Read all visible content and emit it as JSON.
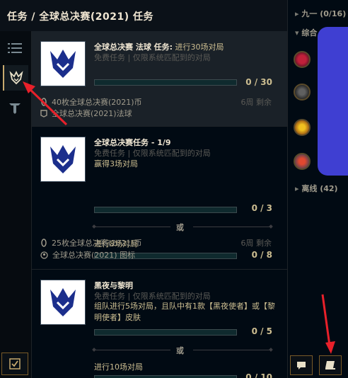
{
  "header": {
    "title": "任务 / 全球总决赛(2021) 任务"
  },
  "nav": {
    "items": [
      {
        "name": "nav-list"
      },
      {
        "name": "nav-worlds"
      },
      {
        "name": "nav-tft"
      }
    ]
  },
  "missions": [
    {
      "title": "全球总决赛 法球 任务:",
      "title_rest": " 进行30场对局",
      "subtitle": "免费任务 | 仅限系统匹配到的对局",
      "progress": "0 / 30",
      "progress_value": 0,
      "time_left": "6周 剩余",
      "rewards": [
        "40枚全球总决赛(2021)币",
        "全球总决赛(2021)法球"
      ]
    },
    {
      "title": "全球总决赛任务 - 1/9",
      "subtitle": "免费任务 | 仅限系统匹配到的对局",
      "objectives": [
        {
          "text": "赢得3场对局",
          "progress": "0 / 3"
        },
        {
          "text": "进行8场对局",
          "progress": "0 / 8"
        }
      ],
      "or_label": "或",
      "time_left": "6周 剩余",
      "rewards": [
        "25枚全球总决赛(2021)币",
        "全球总决赛(2021) 图标"
      ]
    },
    {
      "title": "黑夜与黎明",
      "subtitle": "免费任务 | 仅限系统匹配到的对局",
      "objectives": [
        {
          "text": "组队进行5场对局，且队中有1款【黑夜使者】或【黎明使者】皮肤",
          "progress": "0 / 5"
        },
        {
          "text": "进行10场对局",
          "progress": "0 / 10"
        }
      ],
      "or_label": "或"
    }
  ],
  "social": {
    "group1": "九一 (0/16)",
    "group2": "综合 (4/28)",
    "offline": "离线 (42)"
  },
  "colors": {
    "accent": "#c8aa6e",
    "arrow": "#e8202a",
    "redact": "#3f3fd2"
  }
}
